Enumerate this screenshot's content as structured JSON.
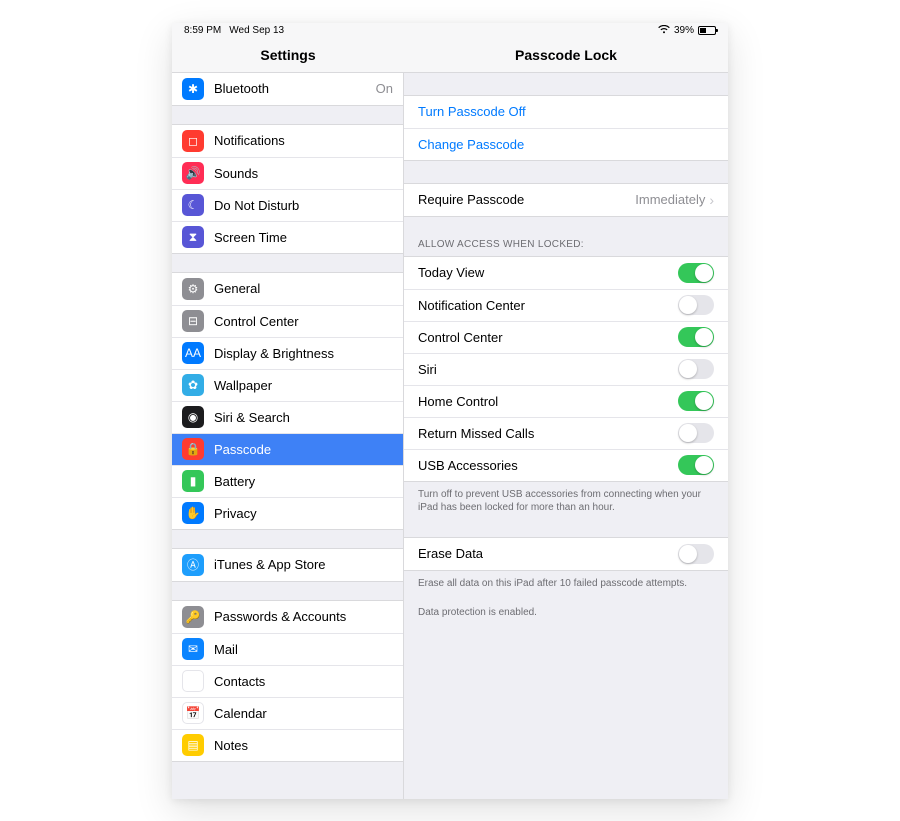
{
  "statusbar": {
    "time": "8:59 PM",
    "date": "Wed Sep 13",
    "battery_pct": "39%"
  },
  "header": {
    "left_title": "Settings",
    "right_title": "Passcode Lock"
  },
  "sidebar": {
    "groups": [
      {
        "rows": [
          {
            "icon": "bluetooth-icon",
            "bg": "bg-blue",
            "glyph": "✱",
            "label": "Bluetooth",
            "value": "On"
          }
        ]
      },
      {
        "rows": [
          {
            "icon": "notifications-icon",
            "bg": "bg-red",
            "glyph": "◻",
            "label": "Notifications"
          },
          {
            "icon": "sounds-icon",
            "bg": "bg-pink",
            "glyph": "🔊",
            "label": "Sounds"
          },
          {
            "icon": "dnd-icon",
            "bg": "bg-purple",
            "glyph": "☾",
            "label": "Do Not Disturb"
          },
          {
            "icon": "screentime-icon",
            "bg": "bg-hour",
            "glyph": "⧗",
            "label": "Screen Time"
          }
        ]
      },
      {
        "rows": [
          {
            "icon": "general-icon",
            "bg": "bg-grey",
            "glyph": "⚙",
            "label": "General"
          },
          {
            "icon": "controlcenter-icon",
            "bg": "bg-grey",
            "glyph": "⊟",
            "label": "Control Center"
          },
          {
            "icon": "display-icon",
            "bg": "bg-blue",
            "glyph": "AA",
            "label": "Display & Brightness"
          },
          {
            "icon": "wallpaper-icon",
            "bg": "bg-cyan",
            "glyph": "✿",
            "label": "Wallpaper"
          },
          {
            "icon": "siri-icon",
            "bg": "bg-navy",
            "glyph": "◉",
            "label": "Siri & Search"
          },
          {
            "icon": "passcode-icon",
            "bg": "bg-red",
            "glyph": "🔒",
            "label": "Passcode",
            "selected": true
          },
          {
            "icon": "battery-icon",
            "bg": "bg-green",
            "glyph": "▮",
            "label": "Battery"
          },
          {
            "icon": "privacy-icon",
            "bg": "bg-blue",
            "glyph": "✋",
            "label": "Privacy"
          }
        ]
      },
      {
        "rows": [
          {
            "icon": "appstore-icon",
            "bg": "bg-azure",
            "glyph": "Ⓐ",
            "label": "iTunes & App Store"
          }
        ]
      },
      {
        "rows": [
          {
            "icon": "passwords-icon",
            "bg": "bg-grey",
            "glyph": "🔑",
            "label": "Passwords & Accounts"
          },
          {
            "icon": "mail-icon",
            "bg": "bg-bright",
            "glyph": "✉",
            "label": "Mail"
          },
          {
            "icon": "contacts-icon",
            "bg": "bg-white",
            "glyph": "☺",
            "label": "Contacts"
          },
          {
            "icon": "calendar-icon",
            "bg": "bg-white",
            "glyph": "📅",
            "label": "Calendar"
          },
          {
            "icon": "notes-icon",
            "bg": "bg-yellow",
            "glyph": "▤",
            "label": "Notes"
          }
        ]
      }
    ]
  },
  "detail": {
    "group1": {
      "turn_off": "Turn Passcode Off",
      "change": "Change Passcode"
    },
    "require": {
      "label": "Require Passcode",
      "value": "Immediately"
    },
    "allow_header": "ALLOW ACCESS WHEN LOCKED:",
    "allow": [
      {
        "label": "Today View",
        "on": true
      },
      {
        "label": "Notification Center",
        "on": false
      },
      {
        "label": "Control Center",
        "on": true
      },
      {
        "label": "Siri",
        "on": false
      },
      {
        "label": "Home Control",
        "on": true
      },
      {
        "label": "Return Missed Calls",
        "on": false
      },
      {
        "label": "USB Accessories",
        "on": true
      }
    ],
    "usb_note": "Turn off to prevent USB accessories from connecting when your iPad has been locked for more than an hour.",
    "erase": {
      "label": "Erase Data",
      "on": false
    },
    "erase_note": "Erase all data on this iPad after 10 failed passcode attempts.",
    "protection_note": "Data protection is enabled."
  }
}
